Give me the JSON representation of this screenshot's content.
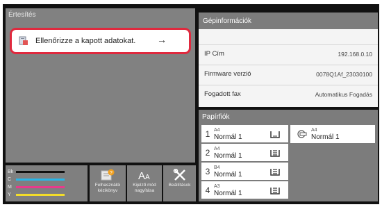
{
  "notifications": {
    "title": "Értesítés",
    "items": [
      {
        "text": "Ellenőrizze a kapott adatokat.",
        "arrow": "→"
      }
    ],
    "highlight_color": "#e0293e"
  },
  "toner": {
    "levels": [
      {
        "label": "Bk",
        "color": "#111111"
      },
      {
        "label": "C",
        "color": "#29b6e8"
      },
      {
        "label": "M",
        "color": "#e83a8c"
      },
      {
        "label": "Y",
        "color": "#f2dd2a"
      }
    ]
  },
  "shortcuts": [
    {
      "label_line1": "Felhasználói",
      "label_line2": "kézikönyv",
      "icon": "user-manual-icon"
    },
    {
      "label_line1": "Kijelző mód",
      "label_line2": "nagyítása",
      "icon": "text-zoom-icon"
    },
    {
      "label_line1": "Beállítások",
      "label_line2": "",
      "icon": "tools-icon"
    }
  ],
  "device_info": {
    "title": "Gépinformációk",
    "rows": [
      {
        "label": "IP Cím",
        "value": "192.168.0.10"
      },
      {
        "label": "Firmware verzió",
        "value": "0078Q1Af_23030100"
      },
      {
        "label": "Fogadott fax",
        "value": "Automatikus Fogadás"
      }
    ]
  },
  "paper_trays": {
    "title": "Papírfiók",
    "trays": [
      {
        "number": "1",
        "size": "A4",
        "paper": "Normál 1",
        "icon": "tray-empty-icon"
      },
      {
        "number": "2",
        "size": "A4",
        "paper": "Normál 1",
        "icon": "tray-full-icon"
      },
      {
        "number": "3",
        "size": "B4",
        "paper": "Normál 1",
        "icon": "tray-full-icon"
      },
      {
        "number": "4",
        "size": "A3",
        "paper": "Normál 1",
        "icon": "tray-full-icon"
      }
    ],
    "bypass": {
      "size": "A4",
      "paper": "Normál 1",
      "icon": "bypass-tray-icon"
    }
  }
}
